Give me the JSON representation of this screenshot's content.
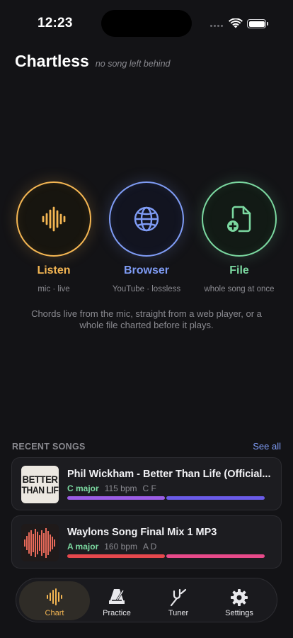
{
  "status_bar": {
    "time": "12:23"
  },
  "header": {
    "title": "Chartless",
    "tagline": "no song left behind"
  },
  "modes": [
    {
      "label": "Listen",
      "subtitle": "mic · live",
      "icon": "waveform-icon",
      "color": "#f4b653"
    },
    {
      "label": "Browser",
      "subtitle": "YouTube · lossless",
      "icon": "globe-icon",
      "color": "#7f9cf5"
    },
    {
      "label": "File",
      "subtitle": "whole song at once",
      "icon": "file-add-icon",
      "color": "#7bd8a0"
    }
  ],
  "description": "Chords live from the mic, straight from a web player, or a whole file charted before it plays.",
  "recent": {
    "title": "RECENT SONGS",
    "see_all": "See all",
    "songs": [
      {
        "title": "Phil Wickham - Better Than Life (Official...",
        "key": "C major",
        "bpm": "115 bpm",
        "chords": "C F",
        "thumb_text": "BETTER THAN LIFE",
        "bar_colors": [
          "#9b5de5",
          "#6a5be8"
        ]
      },
      {
        "title": "Waylons Song Final Mix 1 MP3",
        "key": "A major",
        "bpm": "160 bpm",
        "chords": "A D",
        "thumb_text": "",
        "bar_colors": [
          "#e5484d",
          "#e84a8a"
        ]
      }
    ]
  },
  "tabbar": {
    "tabs": [
      {
        "label": "Chart",
        "icon": "waveform-icon",
        "active": true
      },
      {
        "label": "Practice",
        "icon": "metronome-icon",
        "active": false
      },
      {
        "label": "Tuner",
        "icon": "tuning-fork-icon",
        "active": false
      },
      {
        "label": "Settings",
        "icon": "gear-icon",
        "active": false
      }
    ]
  }
}
